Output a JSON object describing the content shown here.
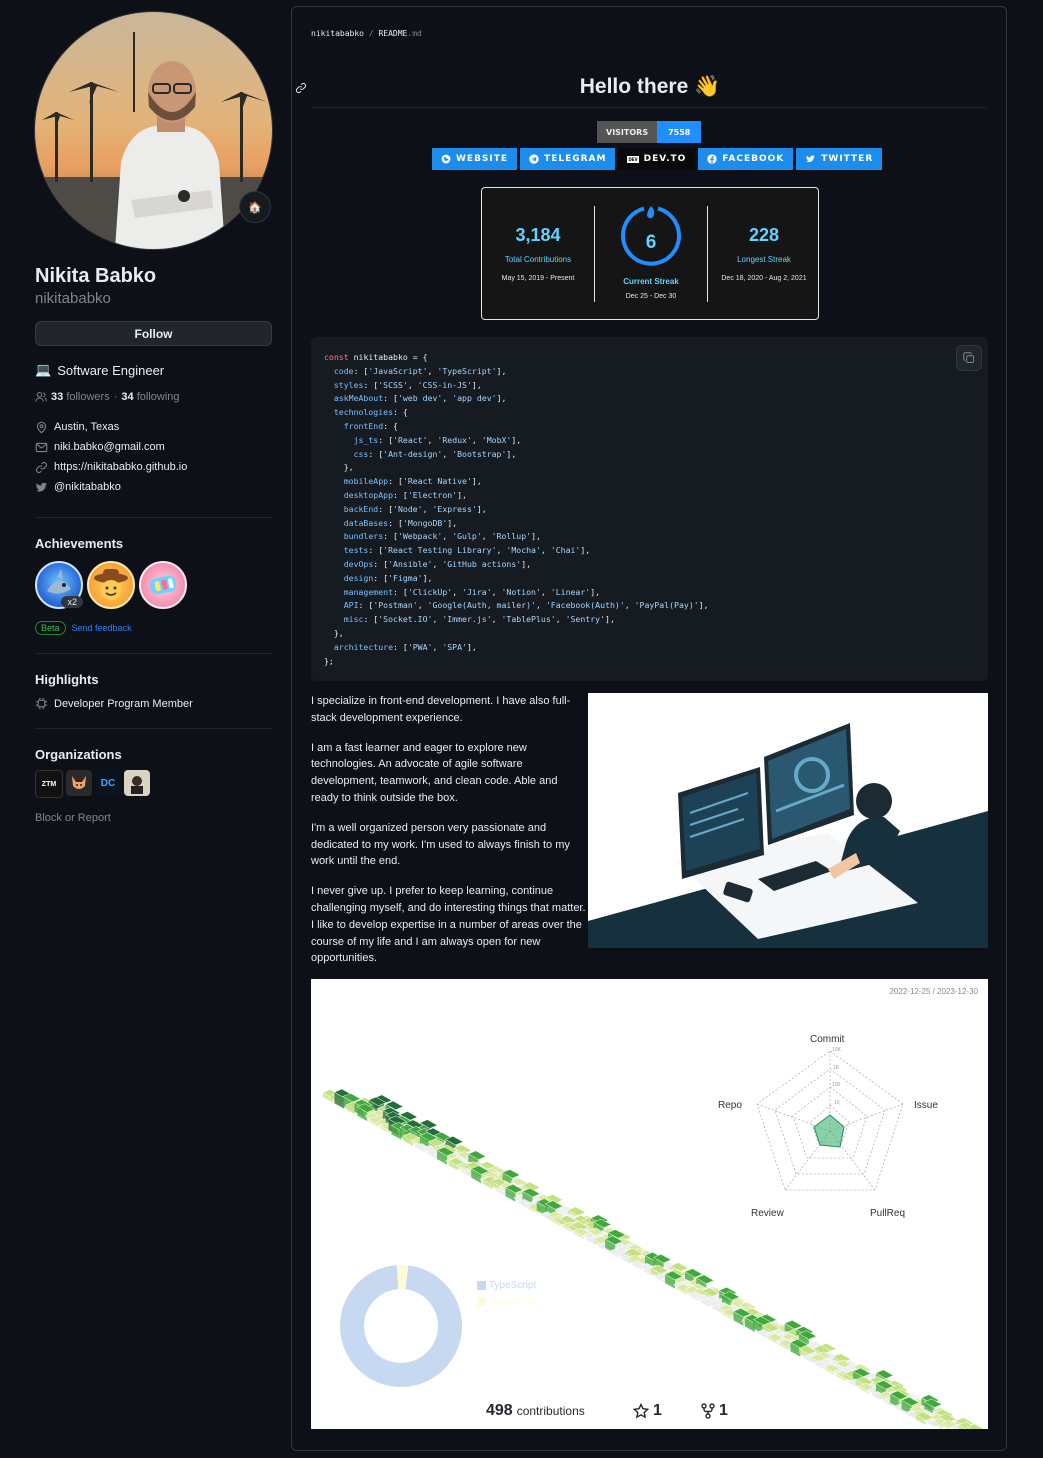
{
  "profile": {
    "name": "Nikita Babko",
    "login": "nikitababko",
    "follow_label": "Follow",
    "status_emoji": "🏠",
    "bio_emoji": "💻",
    "bio": "Software Engineer",
    "followers": "33",
    "followers_label": "followers",
    "following": "34",
    "following_label": "following",
    "separator": "·",
    "location": "Austin, Texas",
    "email": "niki.babko@gmail.com",
    "website": "https://nikitababko.github.io",
    "twitter": "@nikitababko"
  },
  "achievements": {
    "title": "Achievements",
    "multiplier": "x2",
    "beta_label": "Beta",
    "feedback_label": "Send feedback"
  },
  "highlights": {
    "title": "Highlights",
    "item": "Developer Program Member"
  },
  "organizations": {
    "title": "Organizations",
    "logos": [
      "ZTM",
      "DC"
    ]
  },
  "block_report": "Block or Report",
  "readme": {
    "crumb_user": "nikitababko",
    "crumb_sep": "/",
    "crumb_file": "README",
    "crumb_ext": ".md",
    "heading": "Hello there",
    "heading_emoji": "👋",
    "visitors_label": "VISITORS",
    "visitors_count": "7558",
    "shields": [
      "WEBSITE",
      "TELEGRAM",
      "DEV.TO",
      "FACEBOOK",
      "TWITTER"
    ],
    "devto_mark": "DEV"
  },
  "streak": {
    "total": "3,184",
    "total_label": "Total Contributions",
    "total_range": "May 15, 2019 - Present",
    "current": "6",
    "current_label": "Current Streak",
    "current_range": "Dec 25 - Dec 30",
    "longest": "228",
    "longest_label": "Longest Streak",
    "longest_range": "Dec 18, 2020 - Aug 2, 2021"
  },
  "code_lines": [
    "const nikitababko = {",
    "  code: ['JavaScript', 'TypeScript'],",
    "  styles: ['SCSS', 'CSS-in-JS'],",
    "  askMeAbout: ['web dev', 'app dev'],",
    "  technologies: {",
    "    frontEnd: {",
    "      js_ts: ['React', 'Redux', 'MobX'],",
    "      css: ['Ant-design', 'Bootstrap'],",
    "    },",
    "    mobileApp: ['React Native'],",
    "    desktopApp: ['Electron'],",
    "    backEnd: ['Node', 'Express'],",
    "    dataBases: ['MongoDB'],",
    "    bundlers: ['Webpack', 'Gulp', 'Rollup'],",
    "    tests: ['React Testing Library', 'Mocha', 'Chai'],",
    "    devOps: ['Ansible', 'GitHub actions'],",
    "    design: ['Figma'],",
    "    management: ['ClickUp', 'Jira', 'Notion', 'Linear'],",
    "    API: ['Postman', 'Google(Auth, mailer)', 'Facebook(Auth)', 'PayPal(Pay)'],",
    "    misc: ['Socket.IO', 'Immer.js', 'TablePlus', 'Sentry'],",
    "  },",
    "  architecture: ['PWA', 'SPA'],",
    "};"
  ],
  "about": [
    "I specialize in front-end development. I have also full-stack development experience.",
    "I am a fast learner and eager to explore new technologies. An advocate of agile software development, teamwork, and clean code. Able and ready to think outside the box.",
    "I'm a well organized person very passionate and dedicated to my work. I'm used to always finish to my work until the end.",
    "I never give up. I prefer to keep learning, continue challenging myself, and do interesting things that matter. I like to develop expertise in a number of areas over the course of my life and I am always open for new opportunities."
  ],
  "metrics": {
    "date_range": "2022-12-25 / 2023-12-30",
    "radar_labels": [
      "Commit",
      "Issue",
      "PullReq",
      "Review",
      "Repo"
    ],
    "radar_ticks": [
      "10K",
      "1K",
      "100",
      "10"
    ],
    "languages": [
      "TypeScript",
      "JavaScript"
    ],
    "contributions": "498",
    "contributions_label": "contributions",
    "stars": "1",
    "forks": "1"
  },
  "chart_data": {
    "type": "pie",
    "title": "",
    "categories": [
      "TypeScript",
      "JavaScript"
    ],
    "values": [
      97,
      3
    ],
    "colors": [
      "#c6d9f1",
      "#fffbd6"
    ]
  }
}
